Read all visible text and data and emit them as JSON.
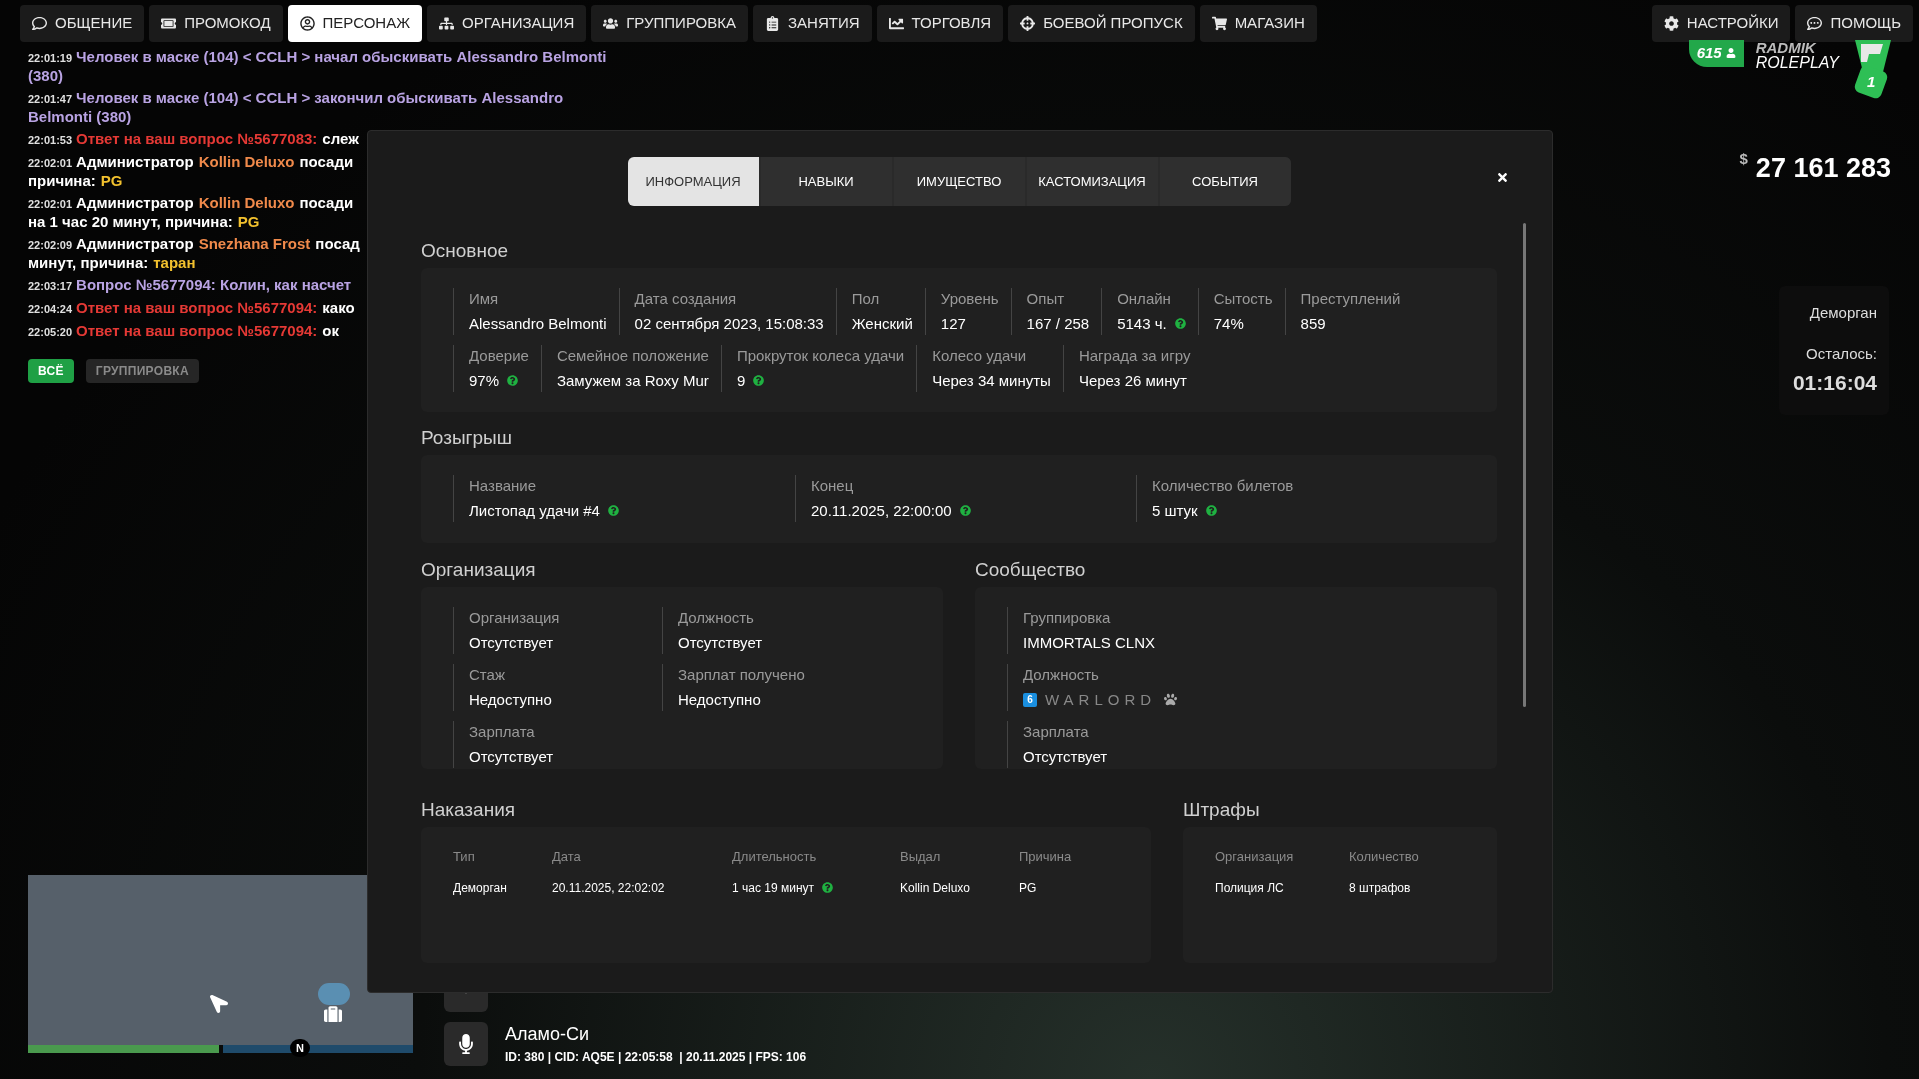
{
  "nav": {
    "left": [
      {
        "label": "ОБЩЕНИЕ",
        "selected": false
      },
      {
        "label": "ПРОМОКОД",
        "selected": false
      },
      {
        "label": "ПЕРСОНАЖ",
        "selected": true
      },
      {
        "label": "ОРГАНИЗАЦИЯ",
        "selected": false
      },
      {
        "label": "ГРУППИРОВКА",
        "selected": false
      },
      {
        "label": "ЗАНЯТИЯ",
        "selected": false
      },
      {
        "label": "ТОРГОВЛЯ",
        "selected": false
      },
      {
        "label": "БОЕВОЙ ПРОПУСК",
        "selected": false
      },
      {
        "label": "МАГАЗИН",
        "selected": false
      }
    ],
    "right": [
      {
        "label": "НАСТРОЙКИ",
        "selected": false
      },
      {
        "label": "ПОМОЩЬ",
        "selected": false
      }
    ]
  },
  "chat": {
    "messages": [
      {
        "time": "22:01:19",
        "parts": [
          {
            "text": "Человек в маске (104) < CCLH > начал обыскивать Alessandro Belmonti",
            "color": "#b9a3e3",
            "newline": false
          },
          {
            "text": "(380)",
            "color": "#b9a3e3",
            "newline": true
          }
        ]
      },
      {
        "time": "22:01:47",
        "parts": [
          {
            "text": "Человек в маске (104) < CCLH > закончил обыскивать Alessandro",
            "color": "#b9a3e3",
            "newline": false
          },
          {
            "text": "Belmonti (380)",
            "color": "#b9a3e3",
            "newline": true
          }
        ]
      },
      {
        "time": "22:01:53",
        "parts": [
          {
            "text": "Ответ на ваш вопрос №5677083:",
            "color": "#e53935",
            "newline": false
          },
          {
            "text": "слеж",
            "color": "#ffffff",
            "newline": false
          }
        ]
      },
      {
        "time": "22:02:01",
        "parts": [
          {
            "text": "Администратор",
            "color": "#ffffff",
            "newline": false
          },
          {
            "text": "Kollin Deluxo",
            "color": "#f08a4b",
            "newline": false
          },
          {
            "text": "посади",
            "color": "#ffffff",
            "newline": false
          },
          {
            "text": "причина:",
            "color": "#ffffff",
            "newline": true
          },
          {
            "text": "PG",
            "color": "#f2c12e",
            "newline": false
          }
        ]
      },
      {
        "time": "22:02:01",
        "parts": [
          {
            "text": "Администратор",
            "color": "#ffffff",
            "newline": false
          },
          {
            "text": "Kollin Deluxo",
            "color": "#f08a4b",
            "newline": false
          },
          {
            "text": "посади",
            "color": "#ffffff",
            "newline": false
          },
          {
            "text": "на 1 час 20 минут, причина:",
            "color": "#ffffff",
            "newline": true
          },
          {
            "text": "PG",
            "color": "#f2c12e",
            "newline": false
          }
        ]
      },
      {
        "time": "22:02:09",
        "parts": [
          {
            "text": "Администратор",
            "color": "#ffffff",
            "newline": false
          },
          {
            "text": "Snezhana Frost",
            "color": "#f08a4b",
            "newline": false
          },
          {
            "text": "посад",
            "color": "#ffffff",
            "newline": false
          },
          {
            "text": "минут, причина:",
            "color": "#ffffff",
            "newline": true
          },
          {
            "text": "таран",
            "color": "#f2c12e",
            "newline": false
          }
        ]
      },
      {
        "time": "22:03:17",
        "parts": [
          {
            "text": "Вопрос №5677094: Колин, как насчет",
            "color": "#b9a3e3",
            "newline": false
          }
        ]
      },
      {
        "time": "22:04:24",
        "parts": [
          {
            "text": "Ответ на ваш вопрос №5677094:",
            "color": "#e53935",
            "newline": false
          },
          {
            "text": "како",
            "color": "#ffffff",
            "newline": false
          }
        ]
      },
      {
        "time": "22:05:20",
        "parts": [
          {
            "text": "Ответ на ваш вопрос №5677094:",
            "color": "#e53935",
            "newline": false
          },
          {
            "text": "ок",
            "color": "#ffffff",
            "newline": false
          }
        ]
      }
    ],
    "filters": [
      {
        "label": "ВСЁ",
        "selected": true
      },
      {
        "label": "ГРУППИРОВКА",
        "selected": false
      }
    ]
  },
  "hud": {
    "online": "615",
    "logo_top": "RADMIK",
    "logo_bottom": "ROLEPLAY",
    "server": "1",
    "currency": "$",
    "money": "27 161 283",
    "jail": {
      "title": "Деморган",
      "remaining_label": "Осталось:",
      "remaining": "01:16:04"
    }
  },
  "modal": {
    "tabs": [
      {
        "label": "ИНФОРМАЦИЯ",
        "selected": true
      },
      {
        "label": "НАВЫКИ",
        "selected": false
      },
      {
        "label": "ИМУЩЕСТВО",
        "selected": false
      },
      {
        "label": "КАСТОМИЗАЦИЯ",
        "selected": false
      },
      {
        "label": "СОБЫТИЯ",
        "selected": false
      }
    ],
    "basic": {
      "title": "Основное",
      "rows": [
        [
          {
            "label": "Имя",
            "value": "Alessandro Belmonti",
            "help": false
          },
          {
            "label": "Дата создания",
            "value": "02 сентября 2023, 15:08:33",
            "help": false
          },
          {
            "label": "Пол",
            "value": "Женский",
            "help": false
          },
          {
            "label": "Уровень",
            "value": "127",
            "help": false
          },
          {
            "label": "Опыт",
            "value": "167 / 258",
            "help": false
          },
          {
            "label": "Онлайн",
            "value": "5143 ч.",
            "help": true
          },
          {
            "label": "Сытость",
            "value": "74%",
            "help": false
          },
          {
            "label": "Преступлений",
            "value": "859",
            "help": false
          }
        ],
        [
          {
            "label": "Доверие",
            "value": "97%",
            "help": true
          },
          {
            "label": "Семейное положение",
            "value": "Замужем за Roxy Mur",
            "help": false
          },
          {
            "label": "Прокруток колеса удачи",
            "value": "9",
            "help": true
          },
          {
            "label": "Колесо удачи",
            "value": "Через 34 минуты",
            "help": false
          },
          {
            "label": "Награда за игру",
            "value": "Через 26 минут",
            "help": false
          }
        ]
      ]
    },
    "raffle": {
      "title": "Розыгрыш",
      "fields": [
        {
          "label": "Название",
          "value": "Листопад удачи #4",
          "help": true
        },
        {
          "label": "Конец",
          "value": "20.11.2025, 22:00:00",
          "help": true
        },
        {
          "label": "Количество билетов",
          "value": "5 штук",
          "help": true
        }
      ]
    },
    "organization": {
      "title": "Организация",
      "fields": [
        {
          "label": "Организация",
          "value": "Отсутствует"
        },
        {
          "label": "Должность",
          "value": "Отсутствует"
        },
        {
          "label": "Стаж",
          "value": "Недоступно"
        },
        {
          "label": "Зарплат получено",
          "value": "Недоступно"
        },
        {
          "label": "Зарплата",
          "value": "Отсутствует"
        }
      ]
    },
    "community": {
      "title": "Сообщество",
      "fields": [
        {
          "kind": "text",
          "label": "Группировка",
          "value": "IMMORTALS CLNX"
        },
        {
          "kind": "rank",
          "label": "Должность",
          "rank": "6",
          "value": "WARLORD"
        },
        {
          "kind": "text",
          "label": "Зарплата",
          "value": "Отсутствует"
        }
      ]
    },
    "punishments": {
      "title": "Наказания",
      "columns": [
        "Тип",
        "Дата",
        "Длительность",
        "Выдал",
        "Причина"
      ],
      "rows": [
        [
          {
            "text": "Деморган",
            "help": false
          },
          {
            "text": "20.11.2025, 22:02:02",
            "help": false
          },
          {
            "text": "1 час 19 минут",
            "help": true
          },
          {
            "text": "Kollin Deluxo",
            "help": false
          },
          {
            "text": "PG",
            "help": false
          }
        ]
      ]
    },
    "fines": {
      "title": "Штрафы",
      "columns": [
        "Организация",
        "Количество"
      ],
      "rows": [
        [
          "Полиция ЛС",
          "8 штрафов"
        ]
      ]
    }
  },
  "minimap": {
    "compass": "N",
    "bars": [
      {
        "level": 1,
        "color": "#4a9a4e"
      },
      {
        "level": 1,
        "color": "#1f4b6b"
      }
    ]
  },
  "location": {
    "name": "Аламо-Си",
    "info": "ID: 380 | CID: AQ5E | 22:05:58  | 20.11.2025 | FPS: 106"
  }
}
